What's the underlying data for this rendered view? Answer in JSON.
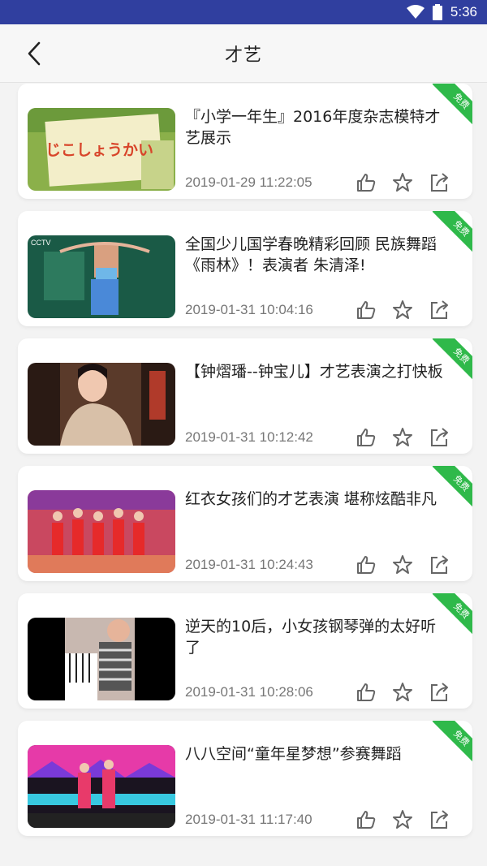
{
  "status_bar": {
    "time": "5:36",
    "wifi_icon": "wifi-icon",
    "battery_icon": "battery-icon"
  },
  "header": {
    "title": "才艺",
    "back_icon": "chevron-left-icon"
  },
  "colors": {
    "status_bar": "#303f9f",
    "badge": "#2fb94a",
    "text": "#222222",
    "date": "#777777"
  },
  "items": [
    {
      "title": "『小学一年生』2016年度杂志模特才艺展示",
      "date": "2019-01-29 11:22:05",
      "badge": "免费",
      "thumb_text": "じこしょうかい"
    },
    {
      "title": "全国少儿国学春晚精彩回顾 民族舞蹈《雨林》！表演者 朱清泽!",
      "date": "2019-01-31 10:04:16",
      "badge": "免费",
      "thumb_text": "CCTV"
    },
    {
      "title": "【钟熠璠--钟宝儿】才艺表演之打快板",
      "date": "2019-01-31 10:12:42",
      "badge": "免费"
    },
    {
      "title": "红衣女孩们的才艺表演 堪称炫酷非凡",
      "date": "2019-01-31 10:24:43",
      "badge": "免费"
    },
    {
      "title": "逆天的10后，小女孩钢琴弹的太好听了",
      "date": "2019-01-31 10:28:06",
      "badge": "免费"
    },
    {
      "title": "八八空间“童年星梦想”参赛舞蹈",
      "date": "2019-01-31 11:17:40",
      "badge": "免费"
    }
  ],
  "action_icons": [
    "thumbs-up-icon",
    "star-icon",
    "share-icon"
  ]
}
